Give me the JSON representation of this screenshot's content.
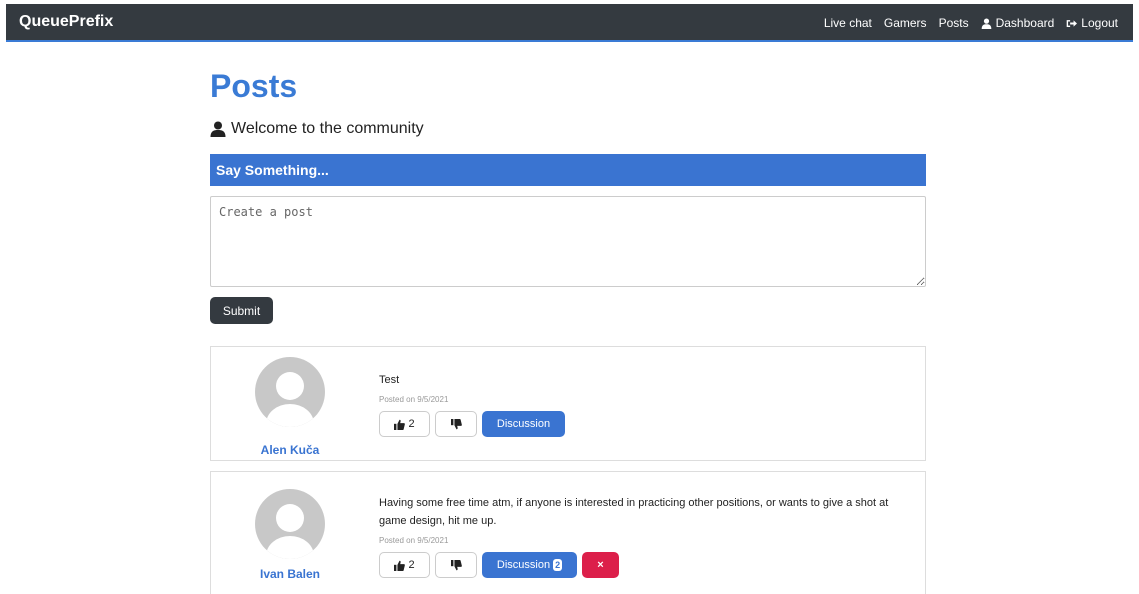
{
  "nav": {
    "brand": "QueuePrefix",
    "links": [
      {
        "label": "Live chat",
        "icon": ""
      },
      {
        "label": "Gamers",
        "icon": ""
      },
      {
        "label": "Posts",
        "icon": ""
      },
      {
        "label": "Dashboard",
        "icon": "user-icon"
      },
      {
        "label": "Logout",
        "icon": "sign-out-icon"
      }
    ]
  },
  "page": {
    "title": "Posts",
    "welcome": "Welcome to the community"
  },
  "compose": {
    "header": "Say Something...",
    "placeholder": "Create a post",
    "submit_label": "Submit"
  },
  "posts": [
    {
      "author": "Alen Kuča",
      "text": "Test",
      "date": "Posted on 9/5/2021",
      "likes": "2",
      "discussion_label": "Discussion",
      "discussion_count": "",
      "can_delete": false
    },
    {
      "author": "Ivan Balen",
      "text": "Having some free time atm, if anyone is interested in practicing other positions, or wants to give a shot at game design, hit me up.",
      "date": "Posted on 9/5/2021",
      "likes": "2",
      "discussion_label": "Discussion",
      "discussion_count": "2",
      "can_delete": true,
      "delete_label": "×"
    }
  ],
  "colors": {
    "navbar": "#343a40",
    "primary": "#3a74d1",
    "danger": "#dc1f4a"
  }
}
